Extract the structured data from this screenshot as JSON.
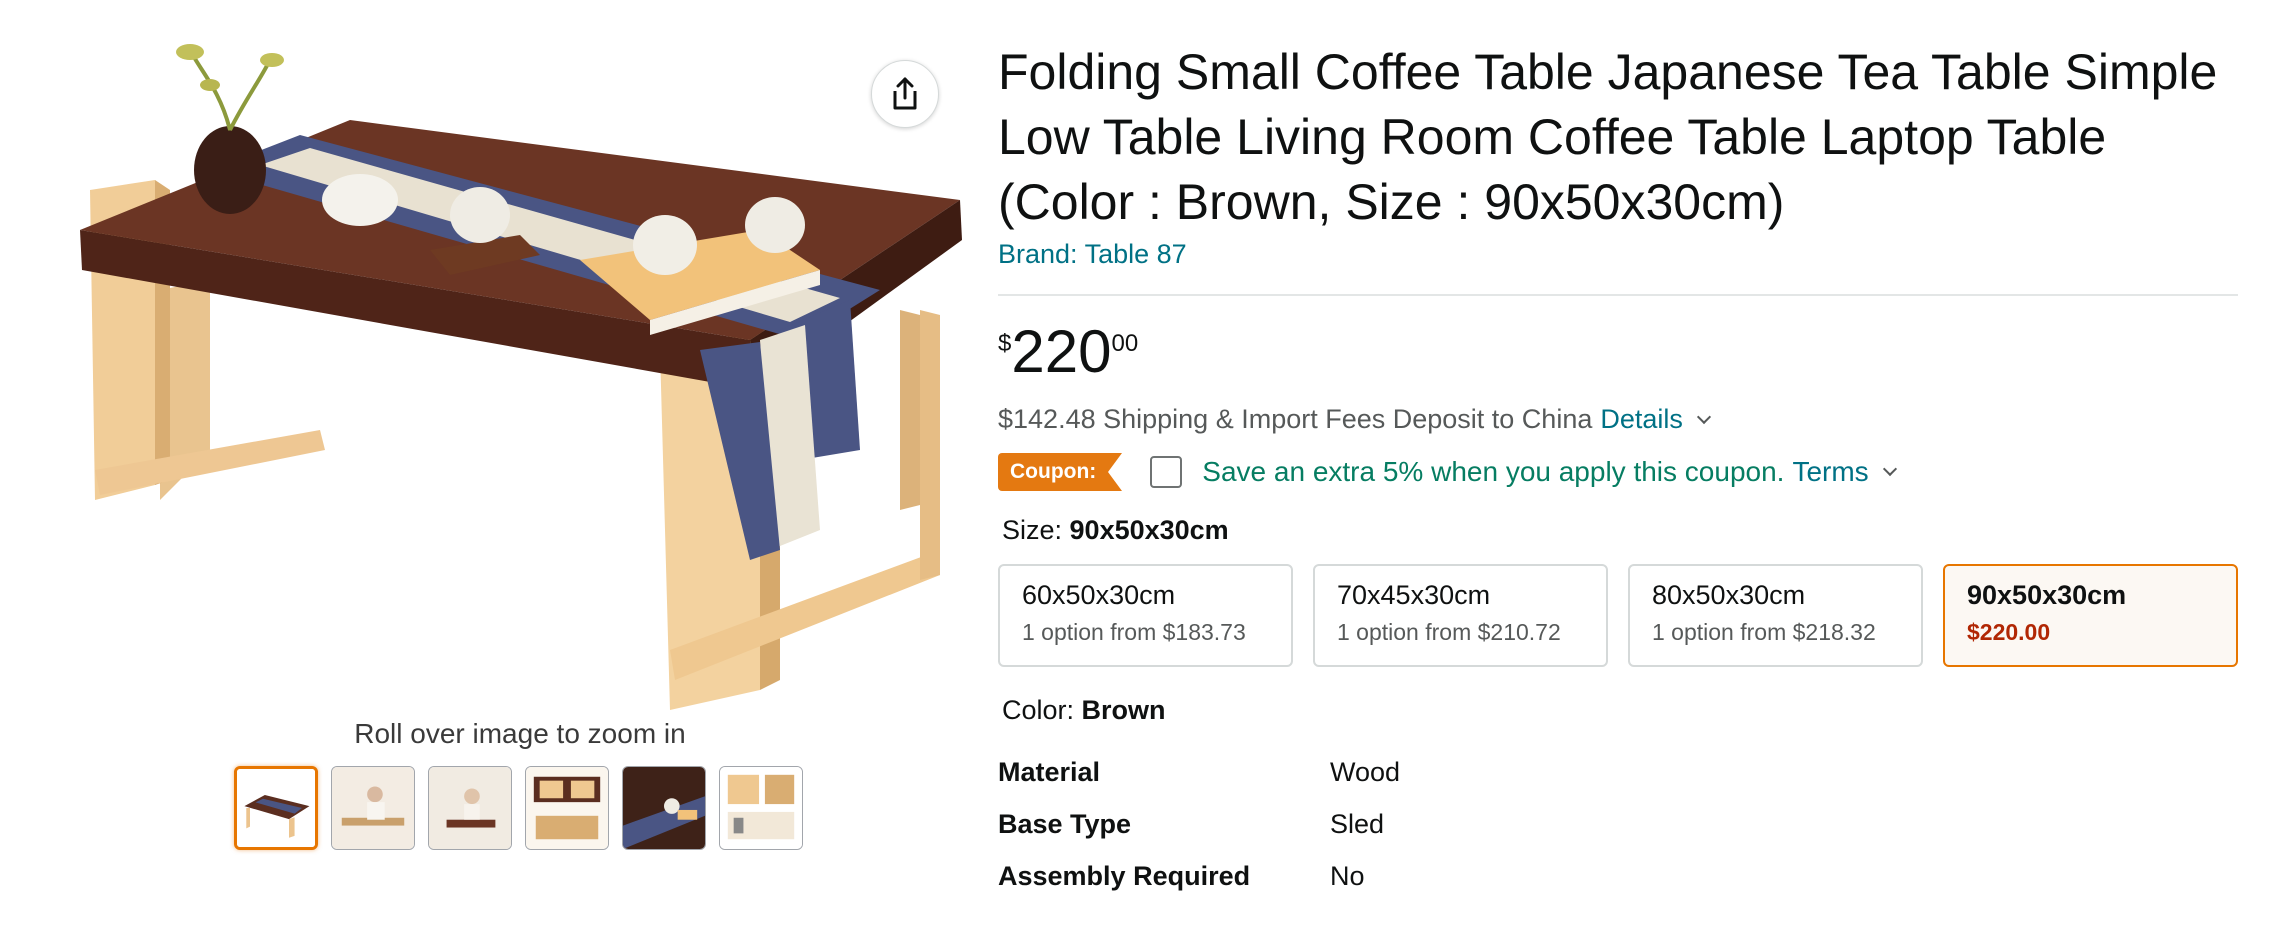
{
  "product": {
    "title": "Folding Small Coffee Table Japanese Tea Table Simple Low Table Living Room Coffee Table Laptop Table (Color : Brown, Size : 90x50x30cm)",
    "brand": "Brand: Table 87"
  },
  "gallery": {
    "zoom_hint": "Roll over image to zoom in",
    "thumbnail_count": 6,
    "active_index": 0
  },
  "price": {
    "symbol": "$",
    "whole": "220",
    "fraction": "00"
  },
  "shipping": {
    "text": "$142.48 Shipping & Import Fees Deposit to China",
    "details_link": "Details"
  },
  "coupon": {
    "tag": "Coupon:",
    "text": "Save an extra 5% when you apply this coupon.",
    "terms_link": "Terms"
  },
  "size": {
    "label": "Size: ",
    "selected": "90x50x30cm",
    "options": [
      {
        "name": "60x50x30cm",
        "sub": "1 option from $183.73"
      },
      {
        "name": "70x45x30cm",
        "sub": "1 option from $210.72"
      },
      {
        "name": "80x50x30cm",
        "sub": "1 option from $218.32"
      },
      {
        "name": "90x50x30cm",
        "sub": "$220.00"
      }
    ]
  },
  "color": {
    "label": "Color: ",
    "selected": "Brown"
  },
  "specs": [
    {
      "key": "Material",
      "value": "Wood"
    },
    {
      "key": "Base Type",
      "value": "Sled"
    },
    {
      "key": "Assembly Required",
      "value": "No"
    }
  ],
  "colors": {
    "link": "#007185",
    "coupon_orange": "#e47911",
    "coupon_green": "#067d62",
    "selected_border": "#e77600",
    "price_red": "#b12704"
  },
  "icons": {
    "share": "share-icon",
    "details_chevron": "chevron-down-icon",
    "terms_chevron": "chevron-down-icon"
  }
}
